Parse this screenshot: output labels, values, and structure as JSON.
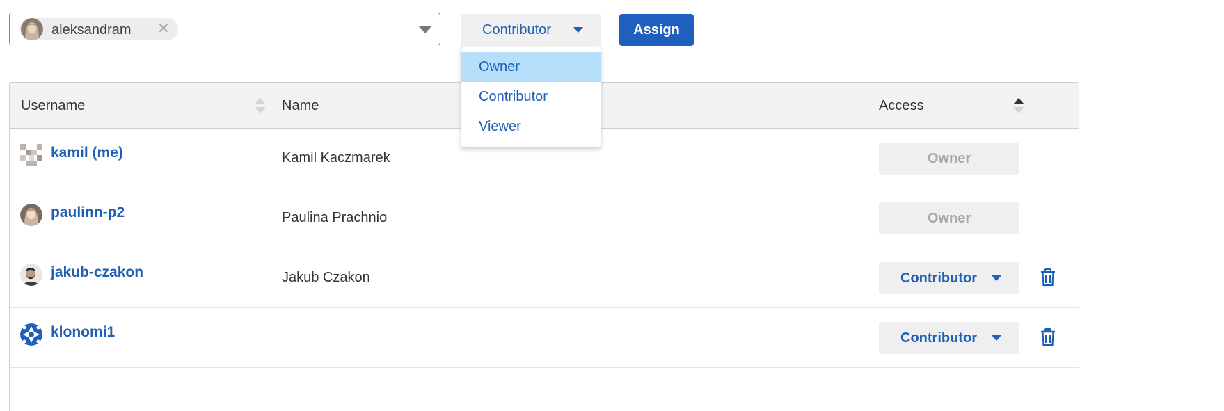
{
  "assign_bar": {
    "selected_user": "aleksandram",
    "remove_symbol": "✕",
    "role_value": "Contributor",
    "assign_label": "Assign"
  },
  "role_menu": {
    "items": [
      {
        "label": "Owner",
        "highlighted": true
      },
      {
        "label": "Contributor",
        "highlighted": false
      },
      {
        "label": "Viewer",
        "highlighted": false
      }
    ]
  },
  "table": {
    "headers": {
      "username": "Username",
      "name": "Name",
      "access": "Access"
    },
    "rows": [
      {
        "username": "kamil (me)",
        "name": "Kamil Kaczmarek",
        "access": "Owner",
        "editable": false,
        "avatar": "pixel-avatar"
      },
      {
        "username": "paulinn-p2",
        "name": "Paulina Prachnio",
        "access": "Owner",
        "editable": false,
        "avatar": "photo-avatar"
      },
      {
        "username": "jakub-czakon",
        "name": "Jakub Czakon",
        "access": "Contributor",
        "editable": true,
        "avatar": "photo-avatar"
      },
      {
        "username": "klonomi1",
        "name": "",
        "access": "Contributor",
        "editable": true,
        "avatar": "pattern-avatar"
      }
    ]
  },
  "colors": {
    "link_blue": "#1f5fb4",
    "button_blue": "#1f5fbf",
    "menu_highlight": "#b6defa",
    "header_bg": "#f2f2f2"
  }
}
